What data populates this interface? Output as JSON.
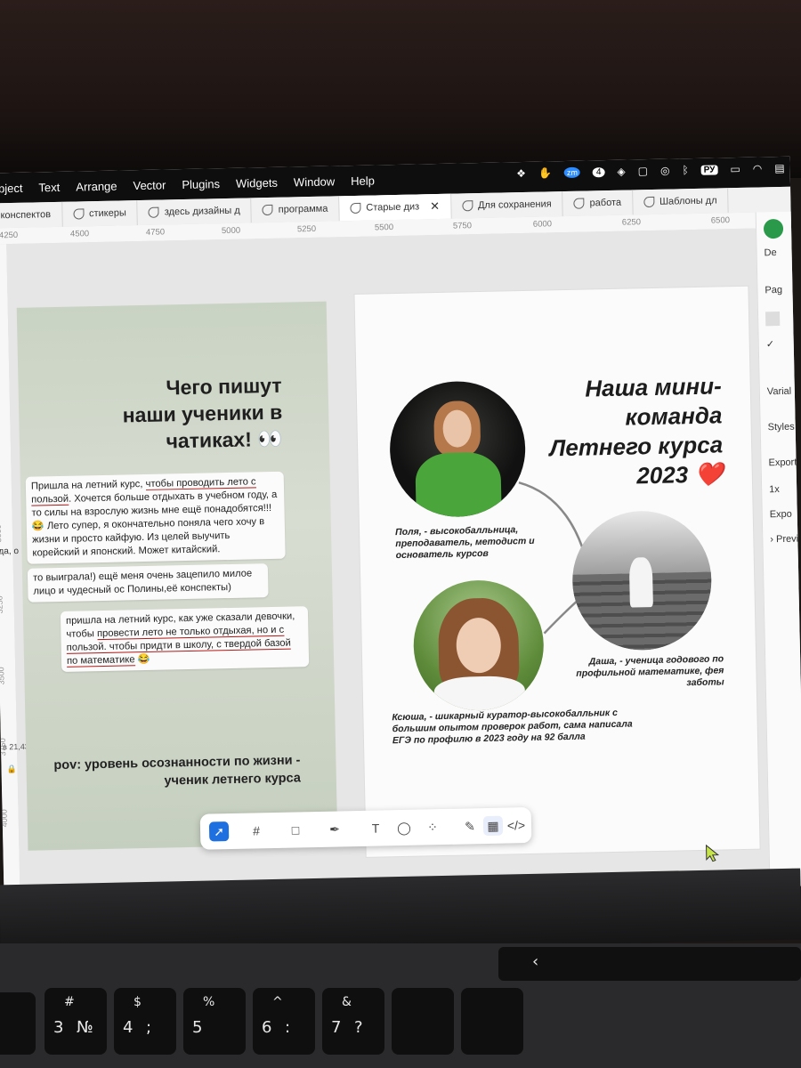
{
  "menubar": {
    "items": [
      "Object",
      "Text",
      "Arrange",
      "Vector",
      "Plugins",
      "Widgets",
      "Window",
      "Help"
    ],
    "status_keyboard": "РУ",
    "status_badge": "4",
    "status_zoom": "zm"
  },
  "tabs": [
    {
      "label": "конспектов",
      "active": false
    },
    {
      "label": "стикеры",
      "active": false
    },
    {
      "label": "здесь дизайны д",
      "active": false
    },
    {
      "label": "программа",
      "active": false
    },
    {
      "label": "Старые диз",
      "active": true
    },
    {
      "label": "Для сохранения",
      "active": false
    },
    {
      "label": "работа",
      "active": false
    },
    {
      "label": "Шаблоны дл",
      "active": false
    }
  ],
  "ruler": {
    "h": [
      "4250",
      "4500",
      "4750",
      "5000",
      "5250",
      "5500",
      "5750",
      "6000",
      "6250",
      "6500"
    ],
    "v": [
      "2250",
      "2500",
      "2750",
      "3000",
      "3250",
      "3500",
      "3750",
      "4000"
    ]
  },
  "left_frame": {
    "title": [
      "Чего пишут",
      "наши ученики в",
      "чатиках! 👀"
    ],
    "msg1": {
      "parts": [
        "Пришла на летний курс, ",
        "чтобы проводить лето с пользой",
        ". Хочется больше отдыхать в учебном году, а то силы на взрослую жизнь мне ещё понадобятся!!! 😂 Лето супер, я окончательно поняла чего хочу в жизни и просто кайфую. Из целей выучить корейский и японский. Может китайский."
      ]
    },
    "msg2": {
      "text": "то выиграла!) ещё меня очень зацепило милое лицо и чудесный ос Полины,её конспекты)"
    },
    "msg3": {
      "parts": [
        "пришла на летний курс, как уже сказали девочки, чтобы ",
        "провести лето не только отдыхая, но и с пользой. чтобы придти в школу, с твердой базой по математике",
        " 😂"
      ]
    },
    "pov": [
      "pov: уровень осознанности по жизни -",
      "ученик летнего курса"
    ],
    "side_label": "да, о",
    "coords": "в 21,43 2"
  },
  "right_frame": {
    "title": [
      "Наша мини-",
      "команда",
      "Летнего курса",
      "2023 ❤️"
    ],
    "polya": "Поля, - высокобалльница, преподаватель, методист и основатель курсов",
    "dasha": "Даша, - ученица годового по профильной математике, фея заботы",
    "ksyusha": "Ксюша, - шикарный куратор-высокобалльник с большим опытом проверок работ, сама написала ЕГЭ по профилю в 2023 году на 92 балла"
  },
  "right_panel": {
    "items": [
      "De",
      "Pag",
      "Varial",
      "Styles",
      "Export",
      "1x",
      "Expo",
      "› Preview"
    ]
  },
  "toolbar": {
    "icons": [
      "move-tool",
      "frame-tool",
      "shape-tool",
      "pen-tool",
      "text-tool",
      "comment-tool",
      "actions-tool",
      "draw-mode",
      "design-mode",
      "dev-mode"
    ]
  },
  "keyboard": {
    "keys": [
      [
        "3",
        "#",
        "№"
      ],
      [
        "4",
        "$",
        ";"
      ],
      [
        "5",
        "%",
        ""
      ],
      [
        "6",
        "^",
        ":"
      ],
      [
        "7",
        "&",
        "?"
      ]
    ]
  },
  "colors": {
    "accent": "#1e6fe0",
    "underline": "#b01818",
    "frame_green": "#c9d3c3"
  }
}
